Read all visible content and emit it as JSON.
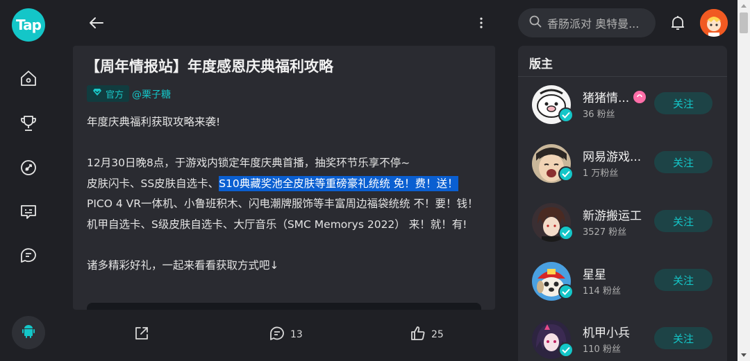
{
  "app": {
    "logo_text": "Tap"
  },
  "topbar": {
    "search_placeholder": "香肠派对 奥特曼..."
  },
  "post": {
    "title": "【周年情报站】年度感恩庆典福利攻略",
    "badge": "官方",
    "author": "@栗子糖",
    "line1": "年度庆典福利获取攻略来袭!",
    "line2": "12月30日晚8点，于游戏内锁定年度庆典首播，抽奖环节乐享不停~",
    "line3a": "皮肤闪卡、SS皮肤自选卡、",
    "line3b": "S10典藏奖池全皮肤等重磅豪礼统统 免！费！送！",
    "line4": "PICO 4 VR一体机、小鲁班积木、闪电潮牌服饰等丰富周边福袋统统 不！要！钱！",
    "line5": "机甲自选卡、S级皮肤自选卡、大厅音乐（SMC Memorys 2022） 来！就！有!",
    "line6": "诸多精彩好礼，一起来看看获取方式吧↓"
  },
  "actions": {
    "comments": "13",
    "likes": "25"
  },
  "sidebar": {
    "title": "版主",
    "follow_label": "关注",
    "mods": [
      {
        "name": "猪猪情...",
        "fans": "36 粉丝"
      },
      {
        "name": "网易游戏...",
        "fans": "1 万粉丝"
      },
      {
        "name": "新游搬运工",
        "fans": "3527 粉丝"
      },
      {
        "name": "星星",
        "fans": "114 粉丝"
      },
      {
        "name": "机甲小兵",
        "fans": "110 粉丝"
      }
    ]
  },
  "colors": {
    "accent": "#14c6c8",
    "highlight": "#0a5fd1",
    "background": "#1f2025",
    "card": "#2a2b31"
  },
  "icons": [
    "home-icon",
    "trophy-icon",
    "rocket-icon",
    "message-card-icon",
    "chat-icon",
    "android-icon",
    "back-arrow-icon",
    "more-icon",
    "search-icon",
    "bell-icon",
    "share-icon",
    "comment-icon",
    "like-icon",
    "verified-icon"
  ]
}
